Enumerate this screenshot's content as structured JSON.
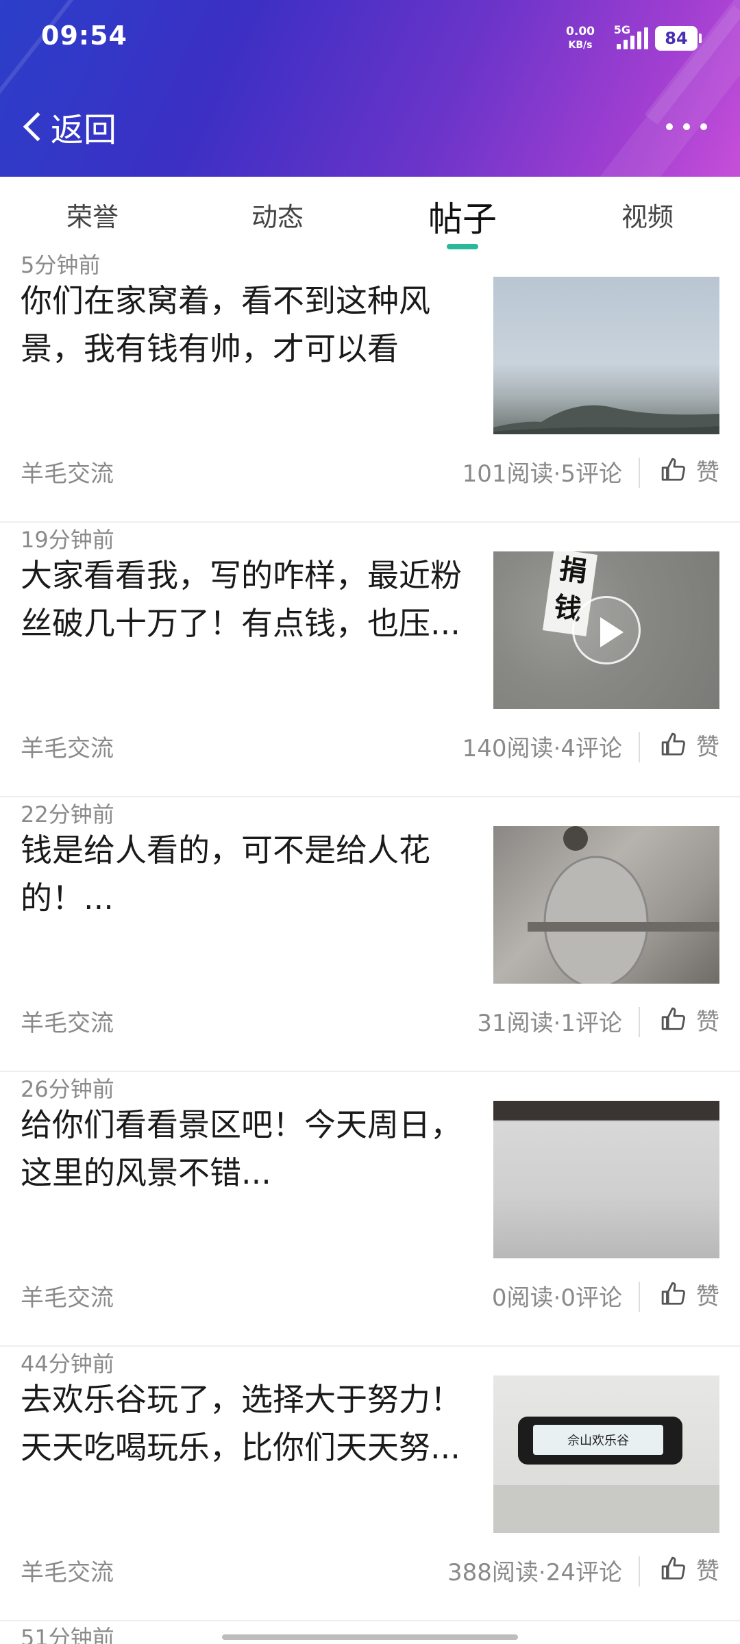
{
  "status_bar": {
    "time": "09:54",
    "net_speed_value": "0.00",
    "net_speed_unit": "KB/s",
    "network": "5G",
    "battery": "84"
  },
  "nav": {
    "back_label": "返回",
    "back_icon": "chevron-left-icon",
    "more_icon": "more-horizontal-icon"
  },
  "tabs": [
    {
      "label": "荣誉",
      "active": false
    },
    {
      "label": "动态",
      "active": false
    },
    {
      "label": "帖子",
      "active": true
    },
    {
      "label": "视频",
      "active": false
    }
  ],
  "posts": [
    {
      "time": "5分钟前",
      "title": "你们在家窝着，看不到这种风景，我有钱有帅，才可以看到！...",
      "author": "羊毛交流",
      "stats": "101阅读·5评论",
      "like_label": "赞",
      "thumb": "sky",
      "video": false
    },
    {
      "time": "19分钟前",
      "title": "大家看看我，写的咋样，最近粉丝破几十万了！有点钱，也压...",
      "author": "羊毛交流",
      "stats": "140阅读·4评论",
      "like_label": "赞",
      "thumb": "wall",
      "video": true
    },
    {
      "time": "22分钟前",
      "title": "钱是给人看的，可不是给人花的！...",
      "author": "羊毛交流",
      "stats": "31阅读·1评论",
      "like_label": "赞",
      "thumb": "metal",
      "video": false
    },
    {
      "time": "26分钟前",
      "title": "给你们看看景区吧！今天周日，这里的风景不错...",
      "author": "羊毛交流",
      "stats": "0阅读·0评论",
      "like_label": "赞",
      "thumb": "white",
      "video": false
    },
    {
      "time": "44分钟前",
      "title": "去欢乐谷玩了，选择大于努力！天天吃喝玩乐，比你们天天努...",
      "author": "羊毛交流",
      "stats": "388阅读·24评论",
      "like_label": "赞",
      "thumb": "bus",
      "video": false
    }
  ],
  "partial_next_time": "51分钟前",
  "thumb_texts": {
    "wall_sign": "捐钱",
    "bus_sign": "佘山欢乐谷"
  },
  "colors": {
    "accent": "#28b89a",
    "header_start": "#2b3fc9",
    "header_end": "#c64fd9"
  }
}
